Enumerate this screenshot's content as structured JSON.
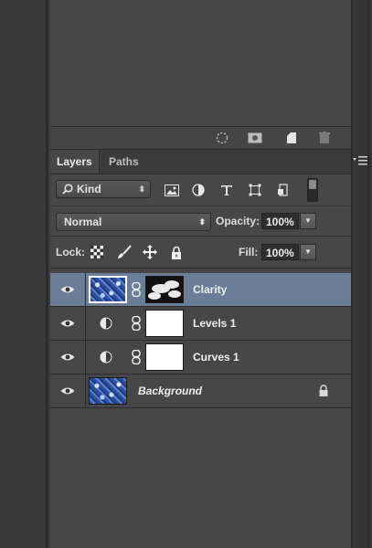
{
  "tabs": [
    {
      "label": "Layers",
      "active": true
    },
    {
      "label": "Paths",
      "active": false
    }
  ],
  "filter": {
    "kind_label": "Kind"
  },
  "blend": {
    "mode": "Normal",
    "opacity_label": "Opacity:",
    "opacity_value": "100%"
  },
  "lock": {
    "label": "Lock:",
    "fill_label": "Fill:",
    "fill_value": "100%"
  },
  "layers": [
    {
      "name": "Clarity",
      "type": "pixel-with-mask",
      "selected": true
    },
    {
      "name": "Levels 1",
      "type": "adjustment",
      "selected": false
    },
    {
      "name": "Curves 1",
      "type": "adjustment",
      "selected": false
    },
    {
      "name": "Background",
      "type": "background",
      "locked": true,
      "selected": false
    }
  ],
  "colors": {
    "panel_bg": "#474747",
    "selected_row": "#6b7e97",
    "field_bg": "#2e2e2e"
  }
}
